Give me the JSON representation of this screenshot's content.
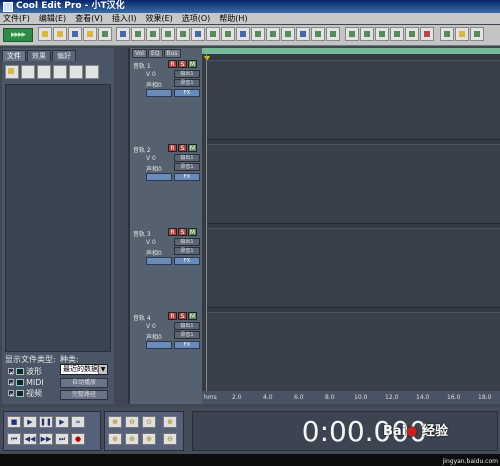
{
  "app": {
    "title": "Cool Edit Pro  - 小T汉化"
  },
  "menu": [
    "文件(F)",
    "编辑(E)",
    "查看(V)",
    "插入(I)",
    "效果(E)",
    "选项(O)",
    "帮助(H)"
  ],
  "left_panel": {
    "tabs": [
      "文件",
      "效果",
      "偏好"
    ],
    "show_types_label": "显示文件类型:",
    "sort_label": "种类:",
    "types": [
      "波形",
      "MIDI",
      "视频"
    ],
    "sort_value": "最近的数据",
    "button_autoplay": "自动播放",
    "button_full_path": "完整路径"
  },
  "track_header": {
    "tabs": [
      "Vol",
      "EQ",
      "Bus"
    ]
  },
  "tracks": [
    {
      "name": "音轨 1",
      "r": "R",
      "s": "S",
      "m": "M",
      "vol": "V 0",
      "pan": "声相0",
      "out": "输出1",
      "rec": "录音1",
      "fx": "FX"
    },
    {
      "name": "音轨 2",
      "r": "R",
      "s": "S",
      "m": "M",
      "vol": "V 0",
      "pan": "声相0",
      "out": "输出1",
      "rec": "录音1",
      "fx": "FX"
    },
    {
      "name": "音轨 3",
      "r": "R",
      "s": "S",
      "m": "M",
      "vol": "V 0",
      "pan": "声相0",
      "out": "输出1",
      "rec": "录音1",
      "fx": "FX"
    },
    {
      "name": "音轨 4",
      "r": "R",
      "s": "S",
      "m": "M",
      "vol": "V 0",
      "pan": "声相0",
      "out": "输出1",
      "rec": "录音1",
      "fx": "FX"
    }
  ],
  "ruler": [
    "hms",
    "2.0",
    "4.0",
    "6.0",
    "8.0",
    "10.0",
    "12.0",
    "14.0",
    "16.0",
    "18.0"
  ],
  "time_display": "0:00.000",
  "watermark": {
    "brand": "Bai",
    "brand2": "经验",
    "url": "jingyan.baidu.com"
  },
  "colors": {
    "accent_green": "#2f8a48",
    "waveform_bg": "#3a404a",
    "record_red": "#c00000"
  }
}
